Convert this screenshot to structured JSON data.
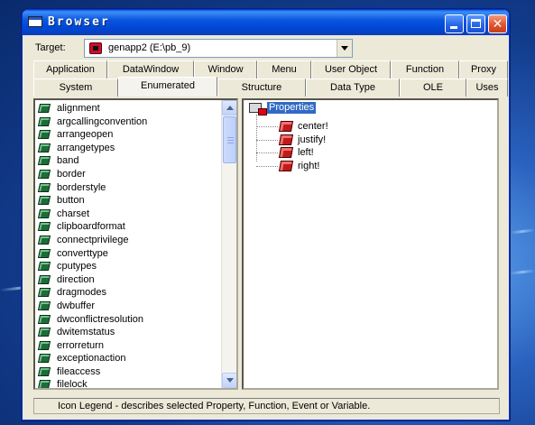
{
  "window": {
    "title": "Browser"
  },
  "target": {
    "label": "Target:",
    "value": "genapp2 (E:\\pb_9)"
  },
  "tabs_row1": [
    {
      "label": "Application"
    },
    {
      "label": "DataWindow"
    },
    {
      "label": "Window"
    },
    {
      "label": "Menu"
    },
    {
      "label": "User Object"
    },
    {
      "label": "Function"
    },
    {
      "label": "Proxy"
    }
  ],
  "tabs_row2": [
    {
      "label": "System"
    },
    {
      "label": "Enumerated"
    },
    {
      "label": "Structure"
    },
    {
      "label": "Data Type"
    },
    {
      "label": "OLE"
    },
    {
      "label": "Uses"
    }
  ],
  "active_tab": "Enumerated",
  "enum_list": [
    "alignment",
    "argcallingconvention",
    "arrangeopen",
    "arrangetypes",
    "band",
    "border",
    "borderstyle",
    "button",
    "charset",
    "clipboardformat",
    "connectprivilege",
    "converttype",
    "cputypes",
    "direction",
    "dragmodes",
    "dwbuffer",
    "dwconflictresolution",
    "dwitemstatus",
    "errorreturn",
    "exceptionaction",
    "fileaccess",
    "filelock"
  ],
  "tree": {
    "root": "Properties",
    "children": [
      "center!",
      "justify!",
      "left!",
      "right!"
    ]
  },
  "status": {
    "text": "Icon Legend - describes selected Property, Function, Event or Variable."
  },
  "colors": {
    "titlebar": "#0a56e0",
    "selection": "#316ac5",
    "enum_icon": "#1f6b3a",
    "property_icon": "#c21a1a",
    "window_face": "#ece9d8"
  }
}
